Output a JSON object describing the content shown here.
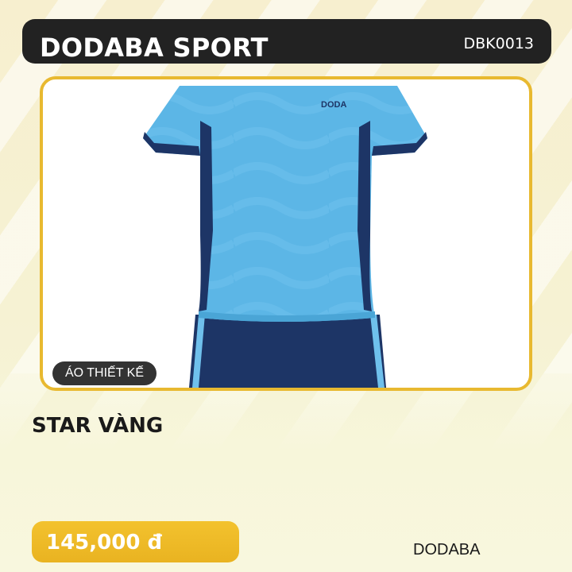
{
  "header": {
    "brand": "DODABA SPORT",
    "sku": "DBK0013"
  },
  "product": {
    "image_icon": "jersey-image",
    "jersey_logo": "DODA",
    "category": "ÁO THIẾT KẾ",
    "name": "STAR VÀNG",
    "price": "145,000 đ",
    "brand": "DODABA"
  },
  "colors": {
    "header_bg": "#222222",
    "accent_yellow": "#e8b930",
    "jersey_light_blue": "#5cb6e6",
    "jersey_navy": "#1d3566"
  }
}
